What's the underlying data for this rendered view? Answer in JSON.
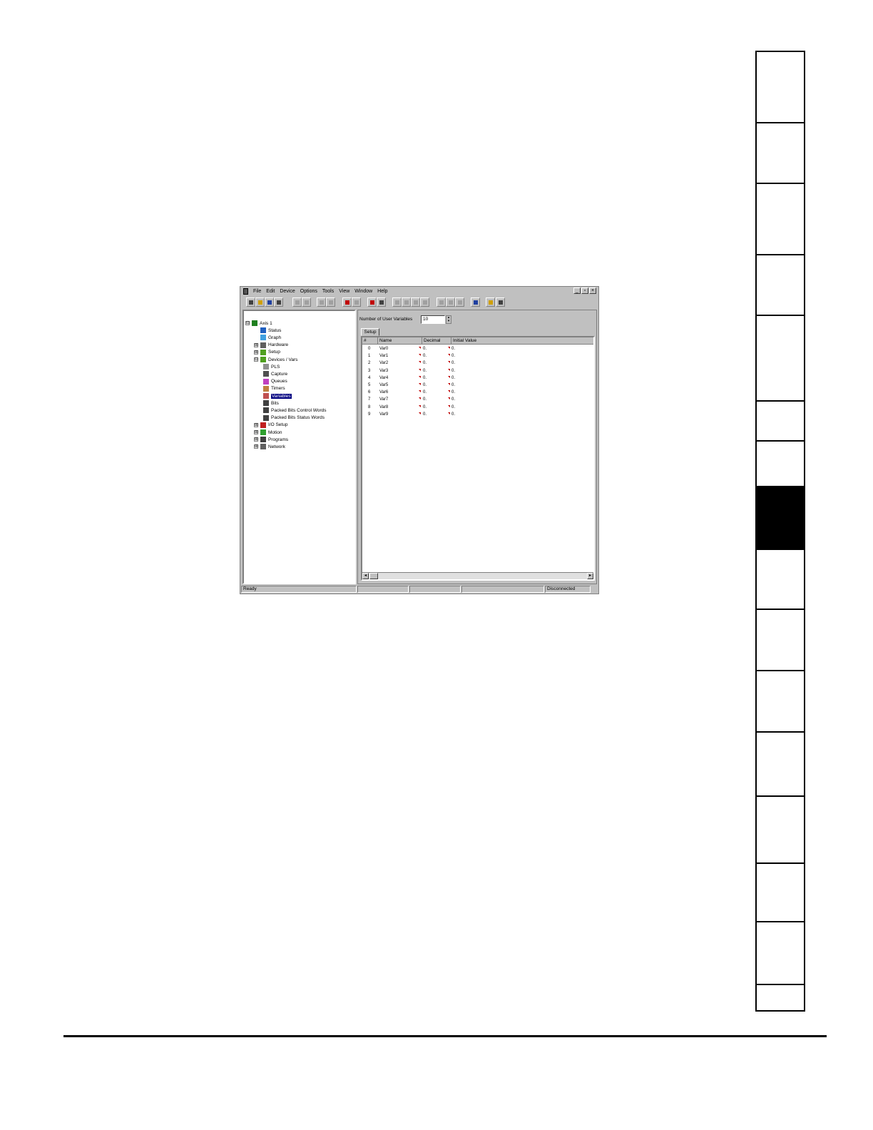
{
  "menu": [
    "File",
    "Edit",
    "Device",
    "Options",
    "Tools",
    "View",
    "Window",
    "Help"
  ],
  "window_buttons": [
    "_",
    "▫",
    "×"
  ],
  "tree": [
    {
      "label": "Axis 1",
      "expander": "⊟",
      "icon": "drive-icon"
    },
    {
      "label": "Status",
      "icon": "monitor-icon"
    },
    {
      "label": "Graph",
      "icon": "graph-icon"
    },
    {
      "label": "Hardware",
      "expander": "⊞",
      "icon": "wrench-icon"
    },
    {
      "label": "Setup",
      "expander": "⊞",
      "icon": "setup-icon"
    },
    {
      "label": "Devices / Vars",
      "expander": "⊟",
      "icon": "setup-icon"
    },
    {
      "label": "PLS",
      "icon": "pls-icon"
    },
    {
      "label": "Capture",
      "icon": "capture-icon"
    },
    {
      "label": "Queues",
      "icon": "queue-icon"
    },
    {
      "label": "Timers",
      "icon": "hourglass-icon"
    },
    {
      "label": "Variables",
      "icon": "variables-icon",
      "selected": true
    },
    {
      "label": "Bits",
      "icon": "bits-icon"
    },
    {
      "label": "Packed Bits Control Words",
      "icon": "bits-icon"
    },
    {
      "label": "Packed Bits Status Words",
      "icon": "bits-icon"
    },
    {
      "label": "I/O Setup",
      "expander": "⊞",
      "icon": "io-icon"
    },
    {
      "label": "Motion",
      "expander": "⊞",
      "icon": "motion-icon"
    },
    {
      "label": "Programs",
      "expander": "⊞",
      "icon": "programs-icon"
    },
    {
      "label": "Network",
      "expander": "⊞",
      "icon": "network-icon"
    }
  ],
  "user_vars": {
    "label": "Number of User Variables",
    "value": "10"
  },
  "tab_label": "Setup",
  "grid": {
    "headers": [
      "#",
      "Name",
      "Decimal",
      "Initial Value"
    ],
    "rows": [
      {
        "num": "0",
        "name": "Var0",
        "decimal": "0.",
        "initial": "0."
      },
      {
        "num": "1",
        "name": "Var1",
        "decimal": "0.",
        "initial": "0."
      },
      {
        "num": "2",
        "name": "Var2",
        "decimal": "0.",
        "initial": "0."
      },
      {
        "num": "3",
        "name": "Var3",
        "decimal": "0.",
        "initial": "0."
      },
      {
        "num": "4",
        "name": "Var4",
        "decimal": "0.",
        "initial": "0."
      },
      {
        "num": "5",
        "name": "Var5",
        "decimal": "0.",
        "initial": "0."
      },
      {
        "num": "6",
        "name": "Var6",
        "decimal": "0.",
        "initial": "0."
      },
      {
        "num": "7",
        "name": "Var7",
        "decimal": "0.",
        "initial": "0."
      },
      {
        "num": "8",
        "name": "Var8",
        "decimal": "0.",
        "initial": "0."
      },
      {
        "num": "9",
        "name": "Var9",
        "decimal": "0.",
        "initial": "0."
      }
    ]
  },
  "status": {
    "left": "Ready",
    "right": "Disconnected"
  },
  "side_tabs": {
    "count": 16,
    "active_index": 7
  }
}
